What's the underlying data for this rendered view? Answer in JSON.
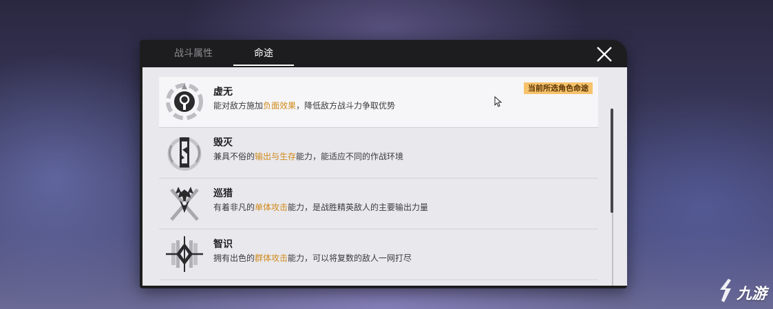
{
  "tabs": [
    {
      "label": "战斗属性",
      "active": false
    },
    {
      "label": "命途",
      "active": true
    }
  ],
  "paths": [
    {
      "name": "虚无",
      "desc_before": "能对敌方施加",
      "desc_highlight": "负面效果",
      "desc_after": "，降低敌方战斗力争取优势",
      "badge": "当前所选角色命途",
      "icon": "nihility-icon",
      "selected": true
    },
    {
      "name": "毁灭",
      "desc_before": "兼具不俗的",
      "desc_highlight": "输出与生存",
      "desc_after": "能力，能适应不同的作战环境",
      "icon": "destruction-icon"
    },
    {
      "name": "巡猎",
      "desc_before": "有着非凡的",
      "desc_highlight": "单体攻击",
      "desc_after": "能力，是战胜精英敌人的主要输出力量",
      "icon": "hunt-icon"
    },
    {
      "name": "智识",
      "desc_before": "拥有出色的",
      "desc_highlight": "群体攻击",
      "desc_after": "能力，可以将复数的敌人一网打尽",
      "icon": "erudition-icon"
    }
  ],
  "colors": {
    "highlight": "#d08a1a",
    "badge_bg": "#f6c26b",
    "panel_header": "#1d1d1f",
    "list_bg": "#e9e8ec"
  },
  "watermark": {
    "text": "九游",
    "icon": "jiuyou-logo-icon"
  }
}
